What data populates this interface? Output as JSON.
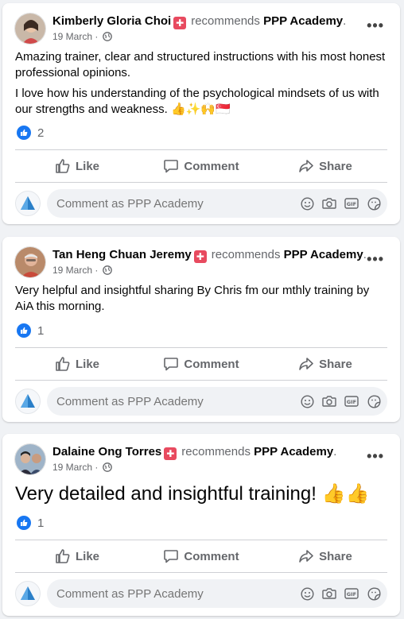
{
  "posts": [
    {
      "author": "Kimberly Gloria Choi",
      "recommends_text": "recommends",
      "page": "PPP Academy",
      "period": ".",
      "date": "19 March ·",
      "paragraphs": [
        "Amazing trainer, clear and structured instructions with his most honest professional opinions.",
        "I love how his understanding of the psychological mindsets of us with our strengths and weakness. 👍✨🙌🇸🇬"
      ],
      "reaction_count": "2"
    },
    {
      "author": "Tan Heng Chuan Jeremy",
      "recommends_text": "recommends",
      "page": "PPP Academy",
      "period": ".",
      "date": "19 March ·",
      "paragraphs": [
        "Very helpful and insightful sharing By Chris fm our mthly training by AiA this morning."
      ],
      "reaction_count": "1"
    },
    {
      "author": "Dalaine Ong Torres",
      "recommends_text": "recommends",
      "page": "PPP Academy",
      "period": ".",
      "date": "19 March ·",
      "paragraphs": [
        "Very detailed and insightful training! 👍👍"
      ],
      "reaction_count": "1"
    }
  ],
  "actions": {
    "like": "Like",
    "comment": "Comment",
    "share": "Share"
  },
  "comment_placeholder": "Comment as PPP Academy",
  "colors": {
    "accent": "#1877f2",
    "badge": "#e84a5f",
    "muted": "#65676b"
  }
}
